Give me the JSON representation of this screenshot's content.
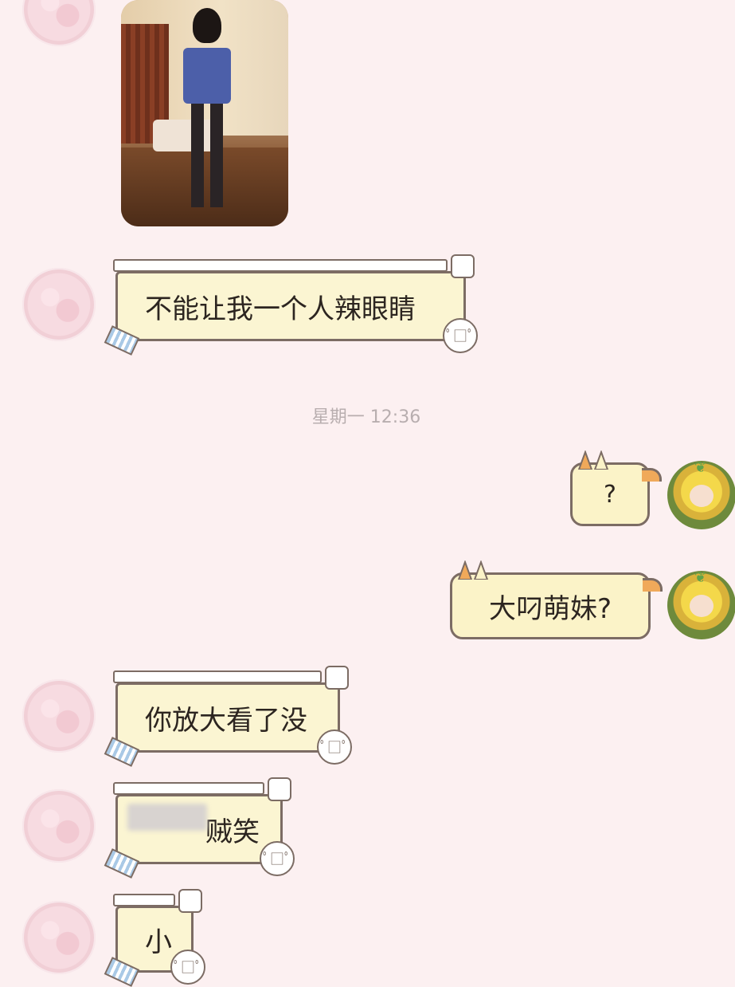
{
  "chat": {
    "timestamp": "星期一 12:36",
    "messages": [
      {
        "side": "left",
        "type": "image",
        "avatar": "friend-avatar"
      },
      {
        "side": "left",
        "type": "text",
        "text": "不能让我一个人辣眼睛"
      },
      {
        "side": "right",
        "type": "text",
        "text": "?"
      },
      {
        "side": "right",
        "type": "text",
        "text": "大叼萌妹?"
      },
      {
        "side": "left",
        "type": "text",
        "text": "你放大看了没"
      },
      {
        "side": "left",
        "type": "text",
        "text": "贼笑",
        "obscured_prefix": true
      },
      {
        "side": "left",
        "type": "text",
        "text": "小"
      }
    ]
  },
  "colors": {
    "background": "#fcf0f1",
    "bubble_left": "#fbf5d2",
    "bubble_right": "#fbf3c8",
    "border": "#7c6c64"
  }
}
